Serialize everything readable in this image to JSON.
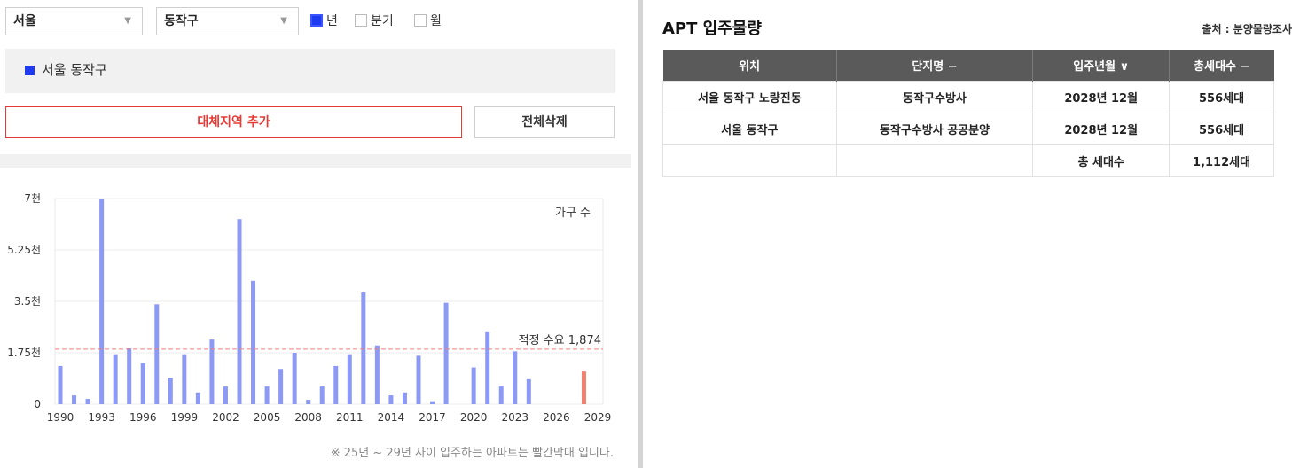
{
  "filters": {
    "city": "서울",
    "district": "동작구",
    "periods": [
      {
        "label": "년",
        "checked": true
      },
      {
        "label": "분기",
        "checked": false
      },
      {
        "label": "월",
        "checked": false
      }
    ]
  },
  "selected_region": "서울 동작구",
  "buttons": {
    "add_region": "대체지역 추가",
    "delete_all": "전체삭제"
  },
  "chart_data": {
    "type": "bar",
    "title": "",
    "legend": "가구 수",
    "x": [
      1990,
      1991,
      1992,
      1993,
      1994,
      1995,
      1996,
      1997,
      1998,
      1999,
      2000,
      2001,
      2002,
      2003,
      2004,
      2005,
      2006,
      2007,
      2008,
      2009,
      2010,
      2011,
      2012,
      2013,
      2014,
      2015,
      2016,
      2017,
      2018,
      2019,
      2020,
      2021,
      2022,
      2023,
      2024,
      2025,
      2026,
      2027,
      2028
    ],
    "values": [
      1300,
      300,
      180,
      7000,
      1700,
      1900,
      1400,
      3400,
      900,
      1700,
      400,
      2200,
      600,
      6300,
      4200,
      600,
      1200,
      1750,
      150,
      600,
      1300,
      1700,
      3800,
      2000,
      300,
      400,
      1650,
      100,
      3450,
      0,
      1250,
      2450,
      600,
      1800,
      850,
      0,
      0,
      0,
      1112
    ],
    "highlight_from": 2025,
    "colors": {
      "normal": "#8d99f6",
      "highlight": "#f08070",
      "reference": "#f08080"
    },
    "ylim": [
      0,
      7000
    ],
    "yticks": [
      0,
      1750,
      3500,
      5250,
      7000
    ],
    "ytick_labels": [
      "0",
      "1.75천",
      "3.5천",
      "5.25천",
      "7천"
    ],
    "xticks": [
      1990,
      1993,
      1996,
      1999,
      2002,
      2005,
      2008,
      2011,
      2014,
      2017,
      2020,
      2023,
      2026,
      2029
    ],
    "reference_line": {
      "value": 1874,
      "label": "적정 수요 1,874"
    }
  },
  "chart_note": "※ 25년 ~ 29년 사이 입주하는 아파트는 빨간막대 입니다.",
  "apt": {
    "title": "APT 입주물량",
    "source": "출처 : 분양물량조사",
    "columns": [
      "위치",
      "단지명 −",
      "입주년월 ∨",
      "총세대수 −"
    ],
    "rows": [
      [
        "서울 동작구 노량진동",
        "동작구수방사",
        "2028년 12월",
        "556세대"
      ],
      [
        "서울 동작구",
        "동작구수방사 공공분양",
        "2028년 12월",
        "556세대"
      ],
      [
        "",
        "",
        "총 세대수",
        "1,112세대"
      ]
    ]
  }
}
